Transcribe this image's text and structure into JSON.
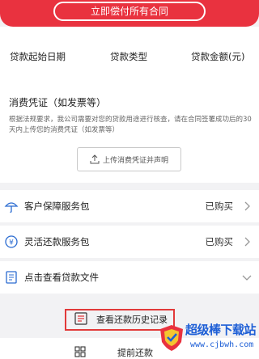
{
  "top_bar": {
    "repay_all_label": "立即偿付所有合同"
  },
  "header": {
    "col1": "贷款起始日期",
    "col2": "贷款类型",
    "col3": "贷款金额(元)"
  },
  "voucher": {
    "title": "消费凭证（如发票等）",
    "description": "根据法规要求，我公司需要对您的贷款用途进行核查，请在合同签署成功后的30 天内上传您的消费凭证（如发票等）",
    "upload_label": "上传消费凭证并声明"
  },
  "rows": [
    {
      "label": "客户保障服务包",
      "status": "已购买",
      "icon": "umbrella-icon"
    },
    {
      "label": "灵活还款服务包",
      "status": "已购买",
      "icon": "coin-icon"
    },
    {
      "label": "点击查看贷款文件",
      "status": "",
      "icon": "document-icon"
    }
  ],
  "history": {
    "label": "查看还款历史记录",
    "icon": "receipt-icon"
  },
  "bottom": {
    "label": "提前还款",
    "icon": "grid-icon"
  },
  "watermark": {
    "title": "超级棒下载站",
    "url": "www.cjbwh.com"
  }
}
